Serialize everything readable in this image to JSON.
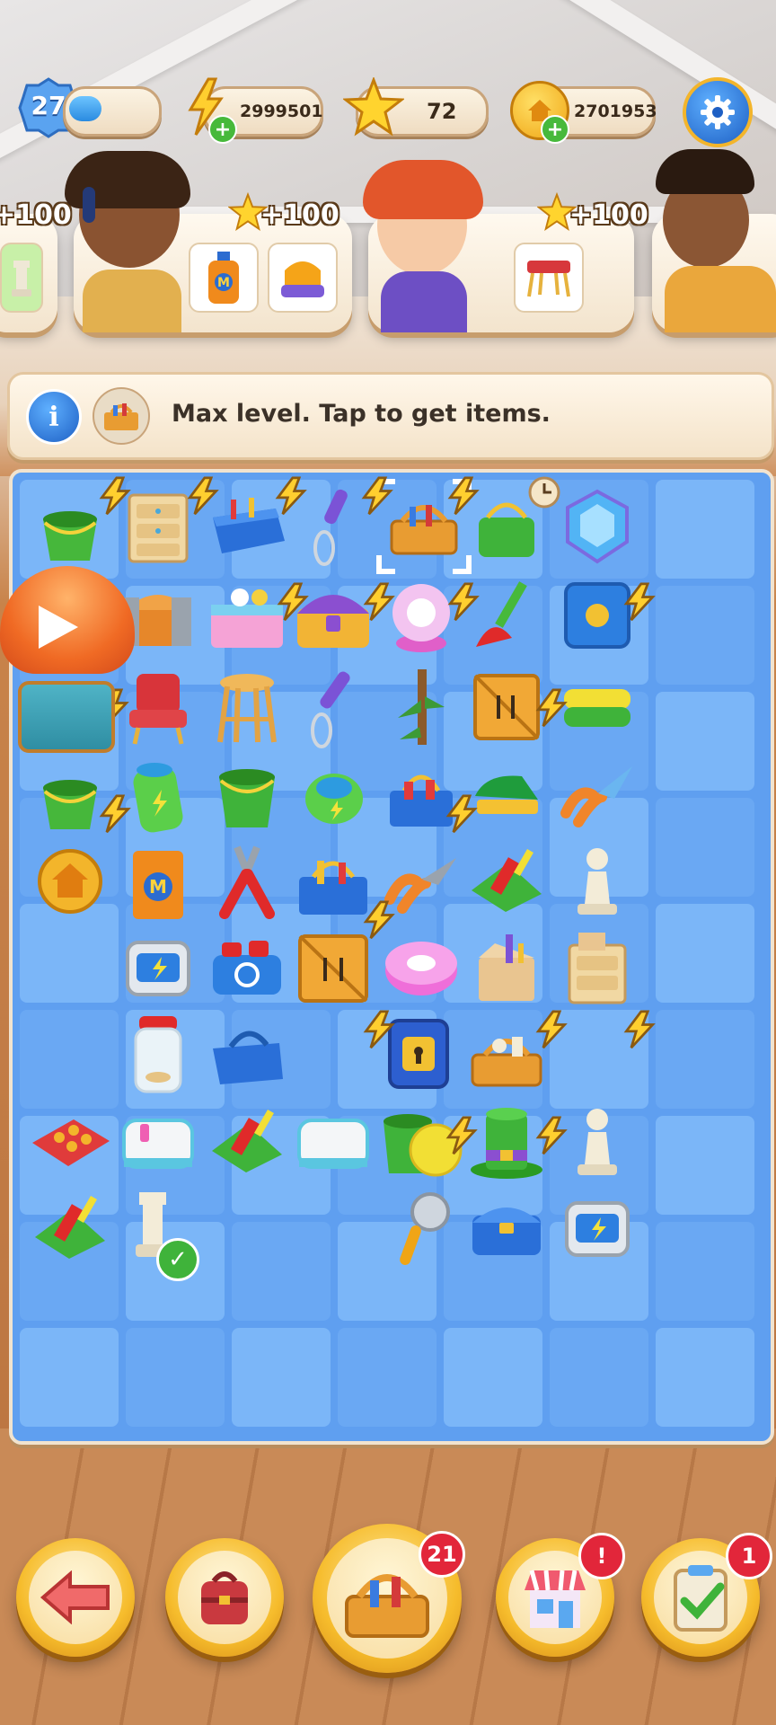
{
  "top_bar": {
    "level": "27",
    "energy": "2999501",
    "stars": "72",
    "coins": "2701953"
  },
  "orders": [
    {
      "reward": "+100"
    },
    {
      "reward": "+100"
    },
    {
      "reward": "+100"
    }
  ],
  "info_banner": {
    "text": "Max level. Tap to get items."
  },
  "inventory_count": "21",
  "shop_badge": "!",
  "tasks_badge": "1",
  "colors": {
    "board_bg": "#5f9ff0",
    "cell_bg": "#7bb6f8",
    "accent_gold": "#f6bc2c",
    "badge_red": "#e2263a"
  },
  "icons": {
    "settings": "gear-icon",
    "energy": "lightning-icon",
    "star": "star-icon",
    "coin": "house-coin-icon",
    "back": "arrow-left-icon",
    "bag": "backpack-icon",
    "shop": "shop-icon",
    "tasks": "clipboard-check-icon"
  }
}
